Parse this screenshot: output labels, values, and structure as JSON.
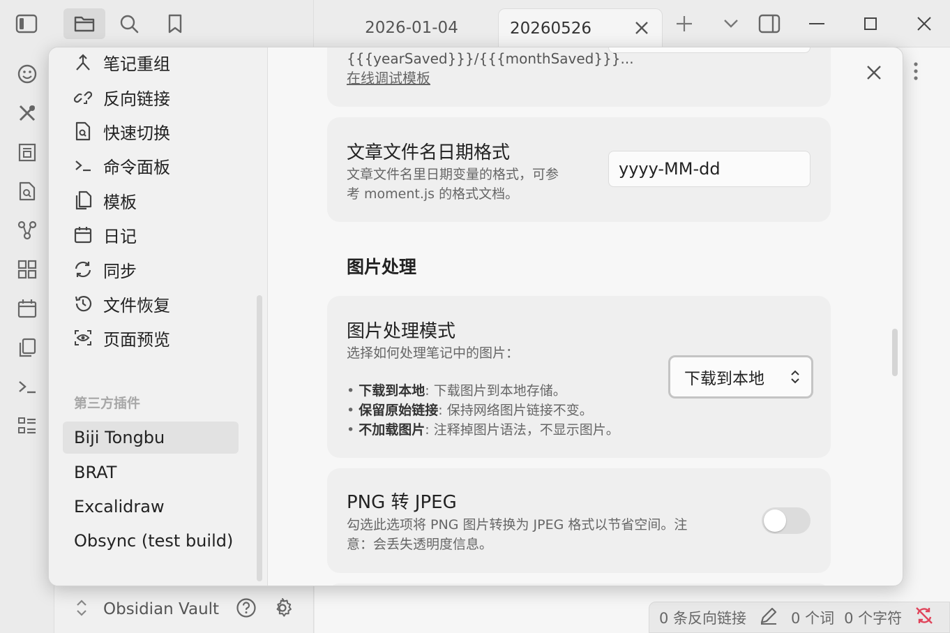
{
  "titlebar": {
    "tabs": [
      {
        "label": "2026-01-04",
        "active": false
      },
      {
        "label": "20260526",
        "active": true
      }
    ]
  },
  "vault": {
    "name": "Obsidian Vault"
  },
  "statusbar": {
    "backlinks": "0 条反向链接",
    "words": "0 个词",
    "chars": "0 个字符"
  },
  "settings_sidebar": {
    "core_plugins": [
      {
        "label": "笔记重组",
        "icon": "note-composer-icon"
      },
      {
        "label": "反向链接",
        "icon": "backlink-icon"
      },
      {
        "label": "快速切换",
        "icon": "quick-switcher-icon"
      },
      {
        "label": "命令面板",
        "icon": "command-palette-icon"
      },
      {
        "label": "模板",
        "icon": "templates-icon"
      },
      {
        "label": "日记",
        "icon": "calendar-icon"
      },
      {
        "label": "同步",
        "icon": "sync-icon"
      },
      {
        "label": "文件恢复",
        "icon": "history-icon"
      },
      {
        "label": "页面预览",
        "icon": "eye-icon"
      }
    ],
    "section_label": "第三方插件",
    "community_plugins": [
      {
        "label": "Biji Tongbu",
        "selected": true
      },
      {
        "label": "BRAT",
        "selected": false
      },
      {
        "label": "Excalidraw",
        "selected": false
      },
      {
        "label": "Obsync (test build)",
        "selected": false
      }
    ]
  },
  "settings_content": {
    "top_card": {
      "template_text": "{{{yearSaved}}}/{{{monthSaved}}}...",
      "link_text": "在线调试模板"
    },
    "date_format": {
      "title": "文章文件名日期格式",
      "desc_line1": "文章文件名里日期变量的格式，可参",
      "desc_line2": "考 moment.js 的格式文档。",
      "value": "yyyy-MM-dd"
    },
    "image_heading": "图片处理",
    "image_mode": {
      "title": "图片处理模式",
      "desc": "选择如何处理笔记中的图片：",
      "bullets": [
        {
          "bold": "下载到本地",
          "text": ": 下载图片到本地存储。"
        },
        {
          "bold": "保留原始链接",
          "text": ": 保持网络图片链接不变。"
        },
        {
          "bold": "不加载图片",
          "text": ": 注释掉图片语法，不显示图片。"
        }
      ],
      "selected": "下载到本地"
    },
    "png_jpeg": {
      "title": "PNG 转 JPEG",
      "desc_line1": "勾选此选项将 PNG 图片转换为 JPEG 格式以节省空间。注",
      "desc_line2": "意：会丢失透明度信息。",
      "enabled": false
    }
  },
  "colors": {
    "link": "#7b5cd6",
    "sync_error": "#e0445a",
    "accent_ui": "#c4c4c4"
  }
}
